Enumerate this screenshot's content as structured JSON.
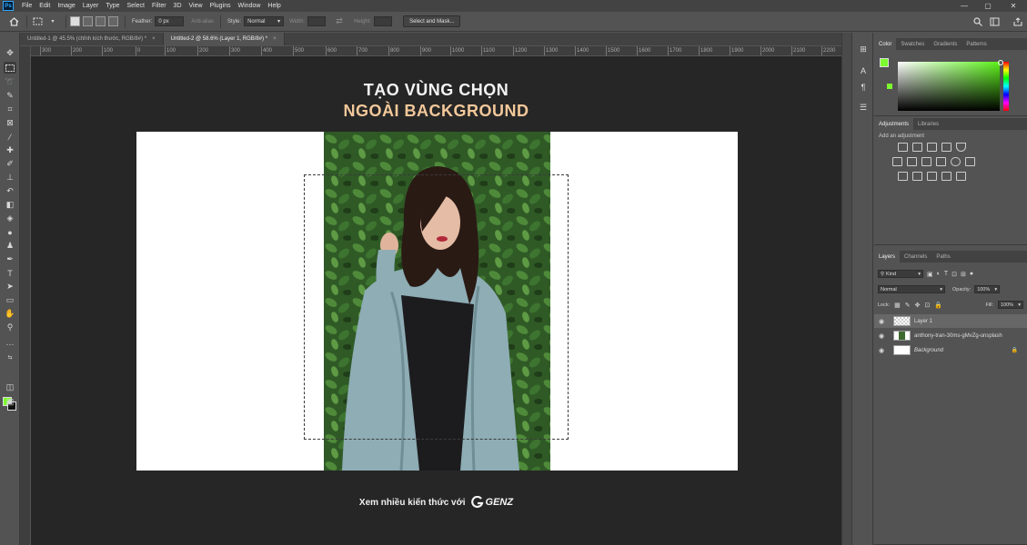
{
  "app": {
    "logo": "Ps",
    "menu": [
      "File",
      "Edit",
      "Image",
      "Layer",
      "Type",
      "Select",
      "Filter",
      "3D",
      "View",
      "Plugins",
      "Window",
      "Help"
    ],
    "window_controls": {
      "minimize": "—",
      "maximize": "▢",
      "close": "✕"
    }
  },
  "options": {
    "feather_label": "Feather:",
    "feather_value": "0 px",
    "antialias_label": "Anti-alias",
    "style_label": "Style:",
    "style_value": "Normal",
    "width_label": "Width:",
    "height_label": "Height:",
    "select_mask_button": "Select and Mask..."
  },
  "tabs": [
    {
      "label": "Untitled-1 @ 45.5% (chỉnh kích thước, RGB/8#) *",
      "close": "×"
    },
    {
      "label": "Untitled-2 @ 58.6% (Layer 1, RGB/8#) *",
      "close": "×"
    }
  ],
  "ruler_ticks": [
    "300",
    "200",
    "100",
    "0",
    "100",
    "200",
    "300",
    "400",
    "500",
    "600",
    "700",
    "800",
    "900",
    "1000",
    "1100",
    "1200",
    "1300",
    "1400",
    "1500",
    "1600",
    "1700",
    "1800",
    "1900",
    "2000",
    "2100",
    "2200"
  ],
  "canvas": {
    "title_line1": "TẠO VÙNG CHỌN",
    "title_line2": "NGOÀI BACKGROUND",
    "footer_text": "Xem nhiều kiến thức với",
    "logo_text": "GENZ",
    "colors": {
      "canvas_bg": "#262626",
      "title_white": "#f4f4f4",
      "title_accent": "#f3c89a"
    }
  },
  "color_panel": {
    "tabs": [
      "Color",
      "Swatches",
      "Gradients",
      "Patterns"
    ],
    "foreground": "#7cfc2e",
    "background": "#111111"
  },
  "adjustments_panel": {
    "tabs": [
      "Adjustments",
      "Libraries"
    ],
    "add_label": "Add an adjustment"
  },
  "layers_panel": {
    "tabs": [
      "Layers",
      "Channels",
      "Paths"
    ],
    "kind_label": "Kind",
    "blend_mode": "Normal",
    "opacity_label": "Opacity:",
    "opacity_value": "100%",
    "lock_label": "Lock:",
    "fill_label": "Fill:",
    "fill_value": "100%",
    "layers": [
      {
        "name": "Layer 1",
        "selected": true
      },
      {
        "name": "anthony-tran-30ms-gMvZg-unsplash",
        "selected": false
      },
      {
        "name": "Background",
        "selected": false
      }
    ]
  }
}
